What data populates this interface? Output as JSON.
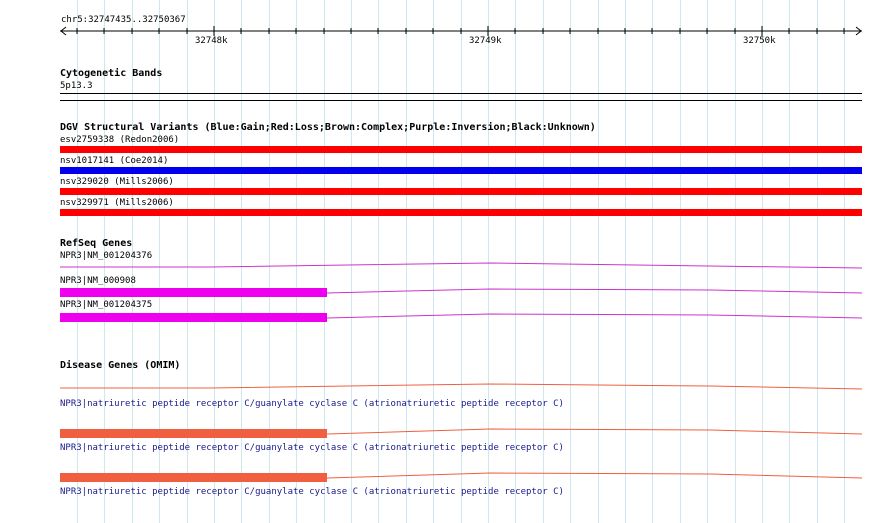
{
  "ruler": {
    "location": "chr5:32747435..32750367",
    "ticks": [
      "32748k",
      "32749k",
      "32750k"
    ]
  },
  "tracks": {
    "cytobands": {
      "title": "Cytogenetic Bands",
      "band": "5p13.3"
    },
    "dgv": {
      "title": "DGV Structural Variants (Blue:Gain;Red:Loss;Brown:Complex;Purple:Inversion;Black:Unknown)",
      "features": [
        {
          "label": "esv2759338 (Redon2006)",
          "color": "#ff0000"
        },
        {
          "label": "nsv1017141 (Coe2014)",
          "color": "#0000ee"
        },
        {
          "label": "nsv329020 (Mills2006)",
          "color": "#ff0000"
        },
        {
          "label": "nsv329971 (Mills2006)",
          "color": "#ff0000"
        }
      ]
    },
    "refseq": {
      "title": "RefSeq Genes",
      "color": "#ee00ee",
      "features": [
        {
          "label": "NPR3|NM_001204376"
        },
        {
          "label": "NPR3|NM_000908"
        },
        {
          "label": "NPR3|NM_001204375"
        }
      ]
    },
    "omim": {
      "title": "Disease Genes (OMIM)",
      "color": "#f06040",
      "features": [
        {
          "label": "NPR3|natriuretic peptide receptor C/guanylate cyclase C (atrionatriuretic peptide receptor C)"
        },
        {
          "label": "NPR3|natriuretic peptide receptor C/guanylate cyclase C (atrionatriuretic peptide receptor C)"
        },
        {
          "label": "NPR3|natriuretic peptide receptor C/guanylate cyclase C (atrionatriuretic peptide receptor C)"
        }
      ]
    }
  }
}
